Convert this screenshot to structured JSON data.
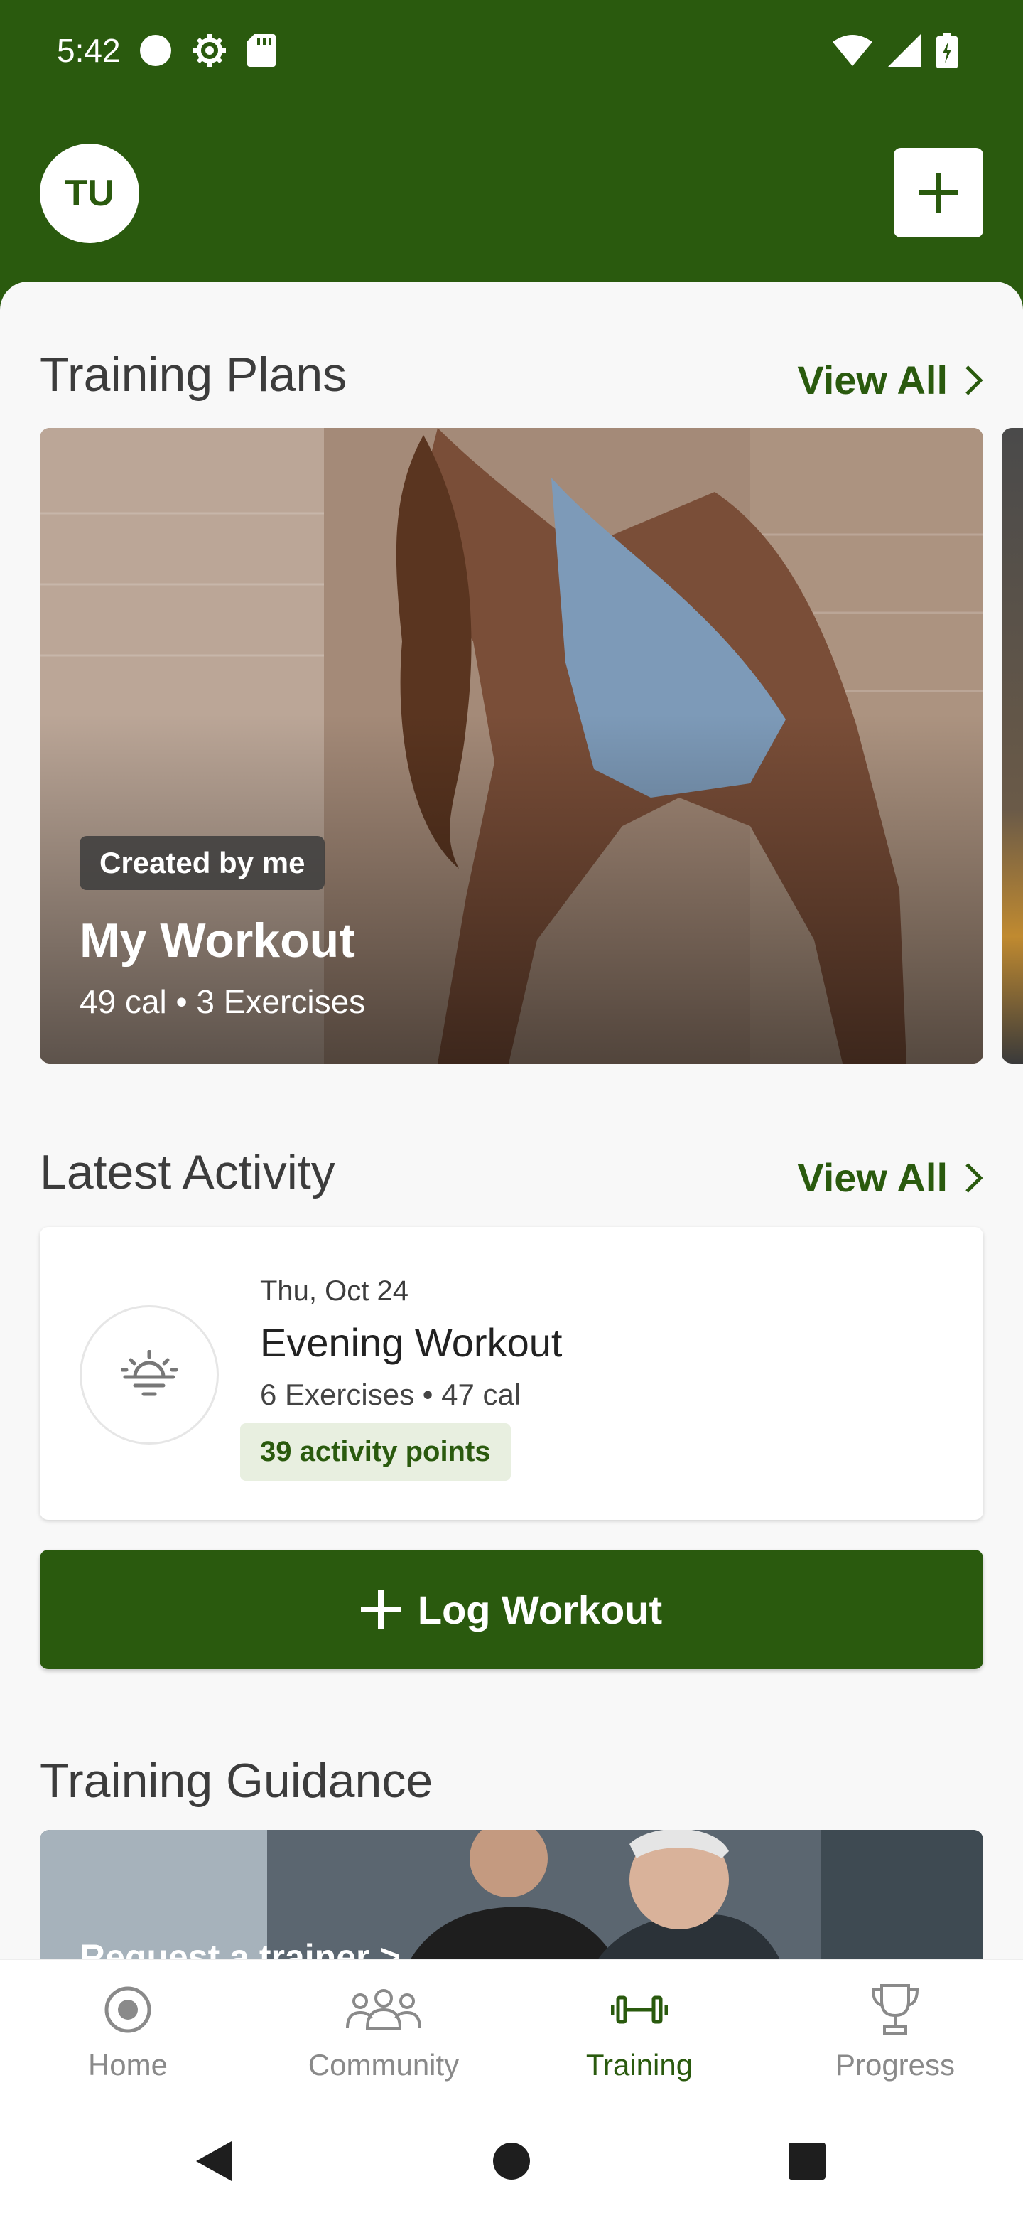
{
  "status_bar": {
    "time": "5:42",
    "left_icons": [
      "circle-icon",
      "gear-icon",
      "sd-card-icon"
    ],
    "right_icons": [
      "wifi-icon",
      "signal-icon",
      "battery-charging-icon"
    ]
  },
  "header": {
    "avatar_initials": "TU",
    "add_icon": "plus-icon"
  },
  "training_plans": {
    "title": "Training Plans",
    "view_all": "View All",
    "card": {
      "badge": "Created by me",
      "title": "My Workout",
      "subtitle": "49 cal • 3 Exercises"
    }
  },
  "latest_activity": {
    "title": "Latest Activity",
    "view_all": "View All",
    "item": {
      "date": "Thu, Oct 24",
      "title": "Evening Workout",
      "subtitle": "6 Exercises • 47 cal",
      "points": "39 activity points",
      "icon": "sunset-icon"
    }
  },
  "log_workout": {
    "label": "Log Workout"
  },
  "training_guidance": {
    "title": "Training Guidance",
    "card_text": "Request a trainer >"
  },
  "bottom_nav": {
    "items": [
      {
        "label": "Home",
        "icon": "home-radio-icon",
        "active": false
      },
      {
        "label": "Community",
        "icon": "community-icon",
        "active": false
      },
      {
        "label": "Training",
        "icon": "dumbbell-icon",
        "active": true
      },
      {
        "label": "Progress",
        "icon": "trophy-icon",
        "active": false
      }
    ]
  },
  "colors": {
    "brand": "#2a5a0e",
    "badge_bg": "#e8efe0"
  }
}
